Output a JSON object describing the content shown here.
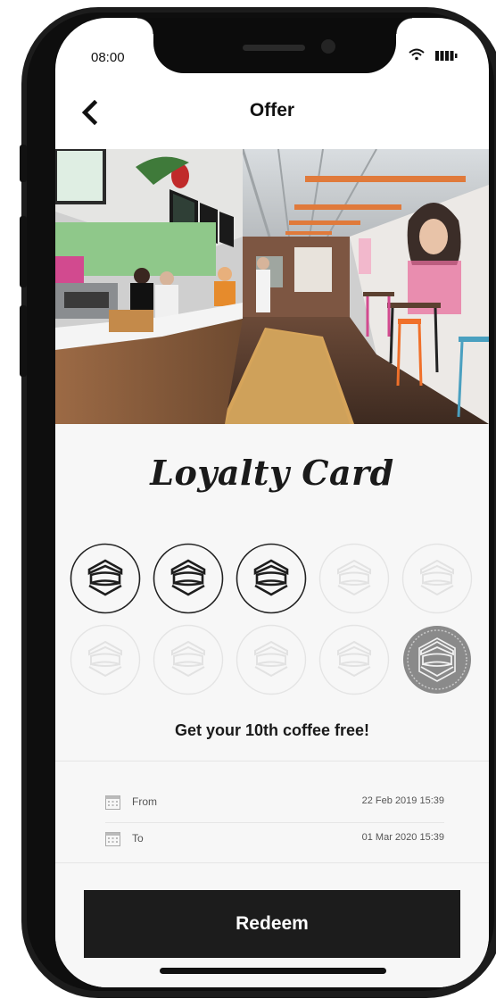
{
  "status_bar": {
    "time": "08:00"
  },
  "header": {
    "title": "Offer"
  },
  "loyalty": {
    "title": "Loyalty Card",
    "stamps_total": 10,
    "stamps_collected": 3,
    "offer": "Get your 10th coffee free!"
  },
  "dates": [
    {
      "label": "From",
      "value": "22 Feb 2019 15:39"
    },
    {
      "label": "To",
      "value": "01 Mar 2020 15:39"
    }
  ],
  "action": {
    "redeem_label": "Redeem"
  },
  "colors": {
    "button": "#1c1c1c",
    "panel": "#f7f7f7",
    "reward_stamp": "#8a8a8a"
  },
  "icons": [
    "back-chevron-icon",
    "wifi-icon",
    "battery-icon",
    "stamp-icon",
    "calendar-icon"
  ]
}
